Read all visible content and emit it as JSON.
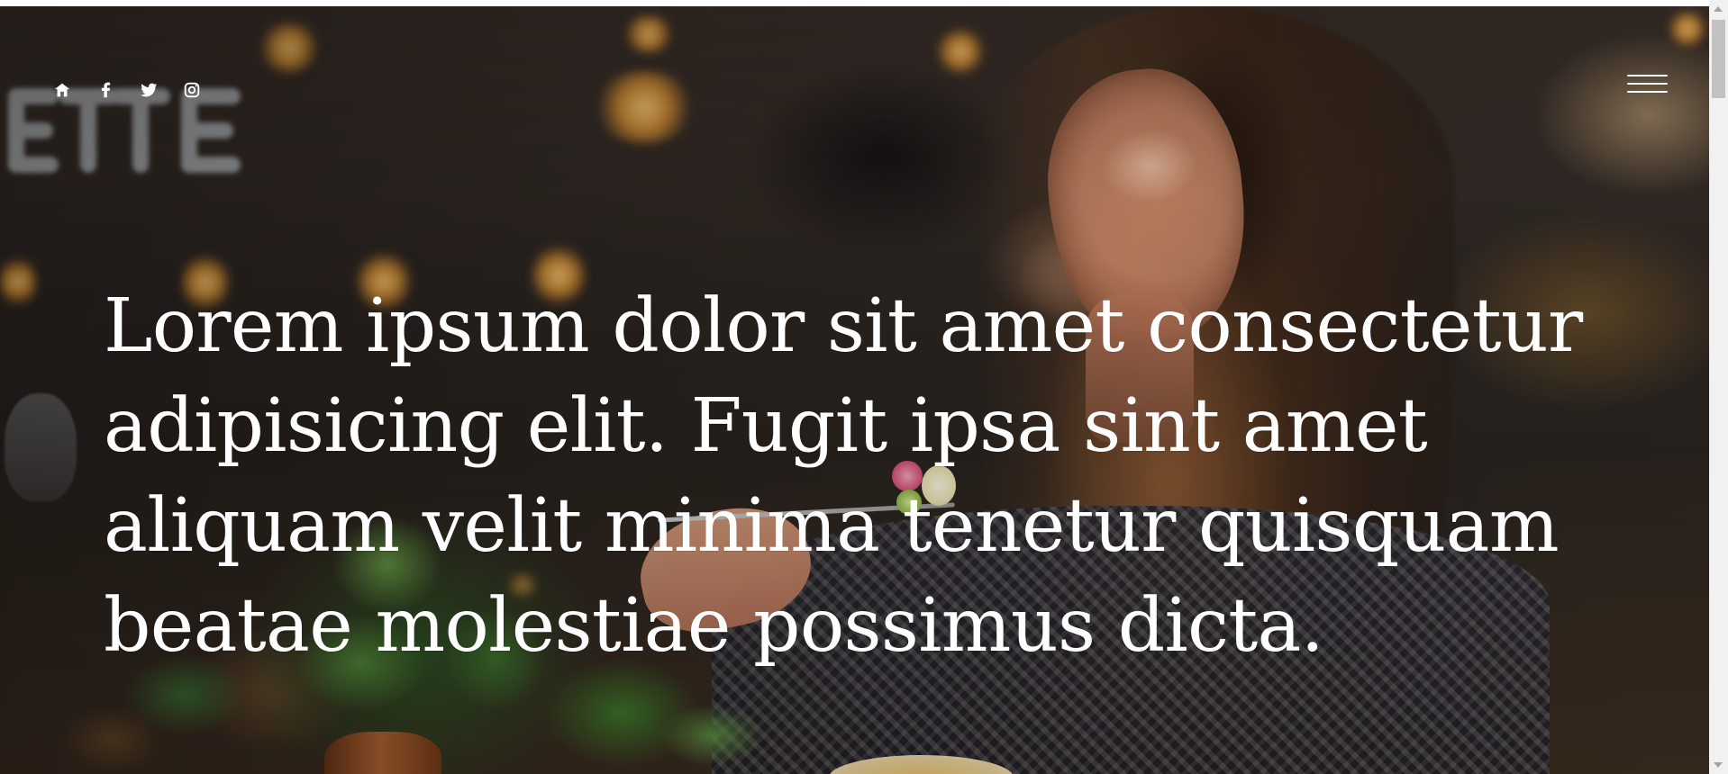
{
  "header": {
    "social_icons": [
      {
        "name": "home-icon"
      },
      {
        "name": "facebook-icon"
      },
      {
        "name": "twitter-icon"
      },
      {
        "name": "instagram-icon"
      }
    ],
    "menu_icon": "hamburger-menu-icon"
  },
  "hero": {
    "heading": "Lorem ipsum dolor sit amet consectetur adipisicing elit. Fugit ipsa sint amet aliquam velit minima tenetur quisquam beatae molestiae possimus dicta."
  },
  "colors": {
    "text": "#ffffff",
    "scrollbar_track": "#f1f1f1",
    "scrollbar_thumb": "#c1c1c1"
  }
}
